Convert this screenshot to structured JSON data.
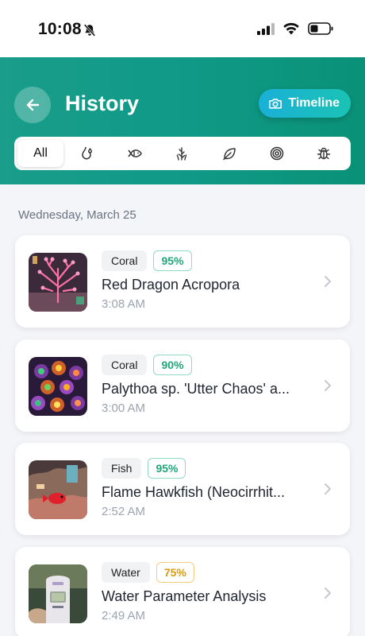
{
  "status_bar": {
    "time": "10:08",
    "icons": [
      "bell-slash-icon",
      "signal-icon",
      "wifi-icon",
      "battery-icon"
    ]
  },
  "header": {
    "title": "History",
    "back_icon": "arrow-left-icon",
    "timeline_button": {
      "label": "Timeline",
      "icon": "camera-icon"
    },
    "gradient_colors": [
      "#1a9d8a",
      "#0a9278"
    ]
  },
  "filters": {
    "items": [
      {
        "label": "All",
        "icon": "",
        "active": true
      },
      {
        "label": "",
        "icon": "water-drop-icon",
        "active": false
      },
      {
        "label": "",
        "icon": "fish-icon",
        "active": false
      },
      {
        "label": "",
        "icon": "seaweed-icon",
        "active": false
      },
      {
        "label": "",
        "icon": "leaf-icon",
        "active": false
      },
      {
        "label": "",
        "icon": "spiral-shell-icon",
        "active": false
      },
      {
        "label": "",
        "icon": "bug-icon",
        "active": false
      }
    ]
  },
  "date_heading": "Wednesday, March 25",
  "entries": [
    {
      "category": "Coral",
      "confidence": "95%",
      "confidence_level": "green",
      "title": "Red Dragon Acropora",
      "time": "3:08 AM",
      "thumb": "pink-coral-photo"
    },
    {
      "category": "Coral",
      "confidence": "90%",
      "confidence_level": "green",
      "title": "Palythoa sp. 'Utter Chaos' a...",
      "time": "3:00 AM",
      "thumb": "zoanthid-photo"
    },
    {
      "category": "Fish",
      "confidence": "95%",
      "confidence_level": "green",
      "title": "Flame Hawkfish (Neocirrhit...",
      "time": "2:52 AM",
      "thumb": "hawkfish-photo"
    },
    {
      "category": "Water",
      "confidence": "75%",
      "confidence_level": "amber",
      "title": "Water Parameter Analysis",
      "time": "2:49 AM",
      "thumb": "water-checker-photo"
    }
  ],
  "colors": {
    "accent_teal": "#109a88",
    "confidence_green": "#1fa67a",
    "confidence_amber": "#d89b10"
  }
}
